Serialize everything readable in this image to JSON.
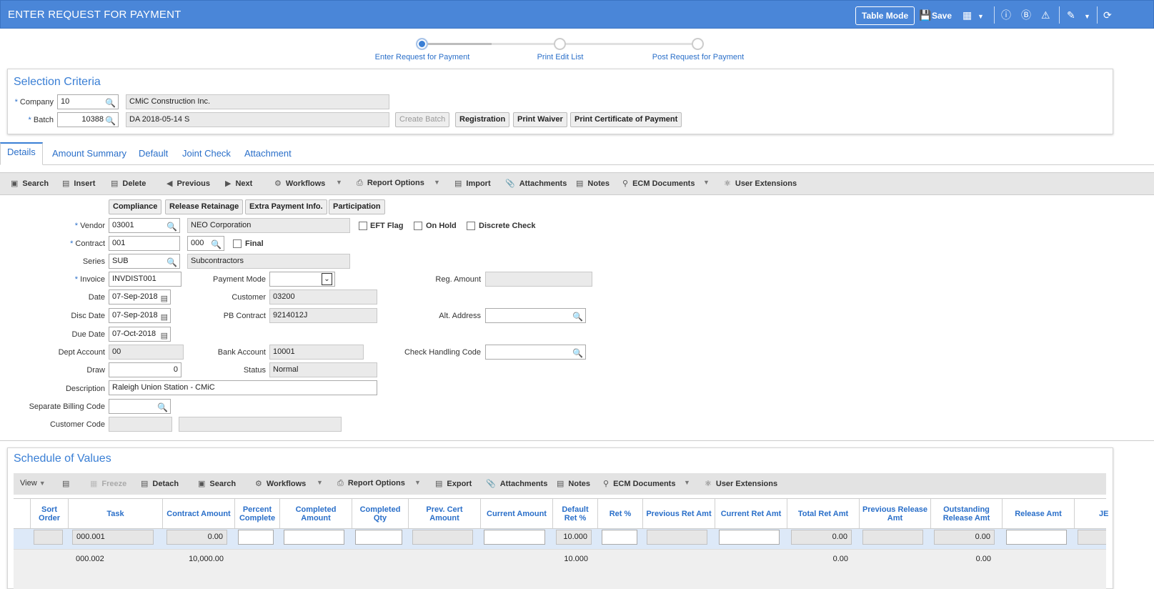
{
  "header": {
    "title": "ENTER REQUEST FOR PAYMENT",
    "table_mode": "Table Mode",
    "save": "Save"
  },
  "steps": [
    {
      "label": "Enter Request for Payment"
    },
    {
      "label": "Print Edit List"
    },
    {
      "label": "Post Request for Payment"
    }
  ],
  "selection": {
    "title": "Selection Criteria",
    "company_label": "Company",
    "company_value": "10",
    "company_name": "CMiC Construction Inc.",
    "batch_label": "Batch",
    "batch_value": "10388",
    "batch_name": "DA 2018-05-14 S",
    "buttons": [
      "Create Batch",
      "Registration",
      "Print Waiver",
      "Print Certificate of Payment"
    ]
  },
  "tabs": [
    "Details",
    "Amount Summary",
    "Default",
    "Joint Check",
    "Attachment"
  ],
  "toolbar": {
    "search": "Search",
    "insert": "Insert",
    "delete": "Delete",
    "previous": "Previous",
    "next": "Next",
    "workflows": "Workflows",
    "report_options": "Report Options",
    "import": "Import",
    "attachments": "Attachments",
    "notes": "Notes",
    "ecm": "ECM Documents",
    "user_ext": "User Extensions"
  },
  "detail_buttons": [
    "Compliance",
    "Release Retainage",
    "Extra Payment Info.",
    "Participation"
  ],
  "form": {
    "vendor_label": "Vendor",
    "vendor": "03001",
    "vendor_name": "NEO Corporation",
    "eft": "EFT Flag",
    "on_hold": "On Hold",
    "discrete": "Discrete Check",
    "contract_label": "Contract",
    "contract": "001",
    "contract2": "000",
    "final": "Final",
    "series_label": "Series",
    "series": "SUB",
    "series_name": "Subcontractors",
    "invoice_label": "Invoice",
    "invoice": "INVDIST001",
    "payment_mode_label": "Payment Mode",
    "reg_amount_label": "Reg. Amount",
    "date_label": "Date",
    "date": "07-Sep-2018",
    "customer_label": "Customer",
    "customer": "03200",
    "disc_date_label": "Disc Date",
    "disc_date": "07-Sep-2018",
    "pb_contract_label": "PB Contract",
    "pb_contract": "9214012J",
    "alt_address_label": "Alt. Address",
    "due_date_label": "Due Date",
    "due_date": "07-Oct-2018",
    "dept_account_label": "Dept Account",
    "dept_account": "00",
    "bank_account_label": "Bank Account",
    "bank_account": "10001",
    "check_handling_label": "Check Handling Code",
    "draw_label": "Draw",
    "draw": "0",
    "status_label": "Status",
    "status": "Normal",
    "description_label": "Description",
    "description": "Raleigh Union Station - CMiC",
    "sep_billing_label": "Separate Billing Code",
    "customer_code_label": "Customer Code"
  },
  "sov": {
    "title": "Schedule of Values",
    "toolbar": {
      "view": "View",
      "freeze": "Freeze",
      "detach": "Detach",
      "search": "Search",
      "workflows": "Workflows",
      "report_options": "Report Options",
      "export": "Export",
      "attachments": "Attachments",
      "notes": "Notes",
      "ecm": "ECM Documents",
      "user_ext": "User Extensions"
    },
    "columns": [
      "Sort Order",
      "Task",
      "Contract Amount",
      "Percent Complete",
      "Completed Amount",
      "Completed Qty",
      "Prev. Cert Amount",
      "Current Amount",
      "Default Ret %",
      "Ret %",
      "Previous Ret Amt",
      "Current Ret Amt",
      "Total Ret Amt",
      "Previous Release Amt",
      "Outstanding Release Amt",
      "Release Amt",
      "JE"
    ],
    "row1": {
      "task": "000.001",
      "contract_amount": "0.00",
      "default_ret": "10.000",
      "total_ret": "0.00",
      "outstanding": "0.00"
    },
    "row2": {
      "task": "000.002",
      "contract_amount": "10,000.00",
      "default_ret": "10.000",
      "total_ret": "0.00",
      "outstanding": "0.00"
    }
  }
}
